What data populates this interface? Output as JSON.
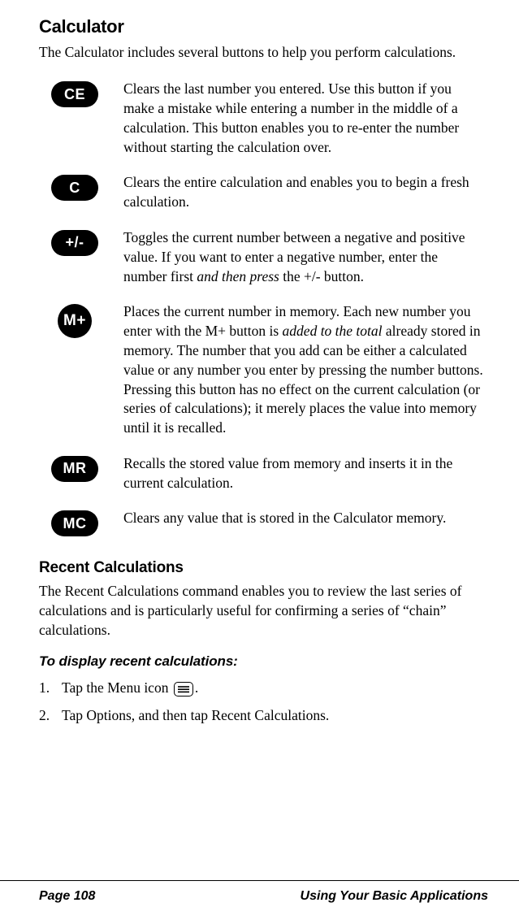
{
  "title": "Calculator",
  "intro": "The Calculator includes several buttons to help you perform calculations.",
  "buttons": [
    {
      "label": "CE",
      "shape": "pill",
      "name": "ce-button-icon",
      "desc_pre": "Clears the last number you entered. Use this button if you make a mistake while entering a number in the middle of a calculation. This button enables you to re-enter the number without starting the calculation over.",
      "desc_em": "",
      "desc_post": ""
    },
    {
      "label": "C",
      "shape": "pill",
      "name": "c-button-icon",
      "desc_pre": "Clears the entire calculation and enables you to begin a fresh calculation.",
      "desc_em": "",
      "desc_post": ""
    },
    {
      "label": "+/-",
      "shape": "pill",
      "name": "plus-minus-button-icon",
      "desc_pre": "Toggles the current number between a negative and positive value. If you want to enter a negative number, enter the number first ",
      "desc_em": "and then press",
      "desc_post": " the +/- button."
    },
    {
      "label": "M+",
      "shape": "circle",
      "name": "m-plus-button-icon",
      "desc_pre": "Places the current number in memory. Each new number you enter with the M+ button is ",
      "desc_em": "added to the total",
      "desc_post": " already stored in memory. The number that you add can be either a calculated value or any number you enter by pressing the number buttons. Pressing this button has no effect on the current calculation (or series of calculations); it merely places the value into memory until it is recalled."
    },
    {
      "label": "MR",
      "shape": "pill",
      "name": "mr-button-icon",
      "desc_pre": "Recalls the stored value from memory and inserts it in the current calculation.",
      "desc_em": "",
      "desc_post": ""
    },
    {
      "label": "MC",
      "shape": "pill",
      "name": "mc-button-icon",
      "desc_pre": "Clears any value that is stored in the Calculator memory.",
      "desc_em": "",
      "desc_post": ""
    }
  ],
  "subhead": "Recent Calculations",
  "subintro": "The Recent Calculations command enables you to review the last series of calculations and is particularly useful for confirming a series of “chain” calculations.",
  "howto": "To display recent calculations:",
  "steps": {
    "s1_num": "1.",
    "s1_text_pre": "Tap the Menu icon ",
    "s1_text_post": ".",
    "s2_num": "2.",
    "s2_text": "Tap Options, and then tap Recent Calculations."
  },
  "footer": {
    "left": "Page 108",
    "right": "Using Your Basic Applications"
  }
}
